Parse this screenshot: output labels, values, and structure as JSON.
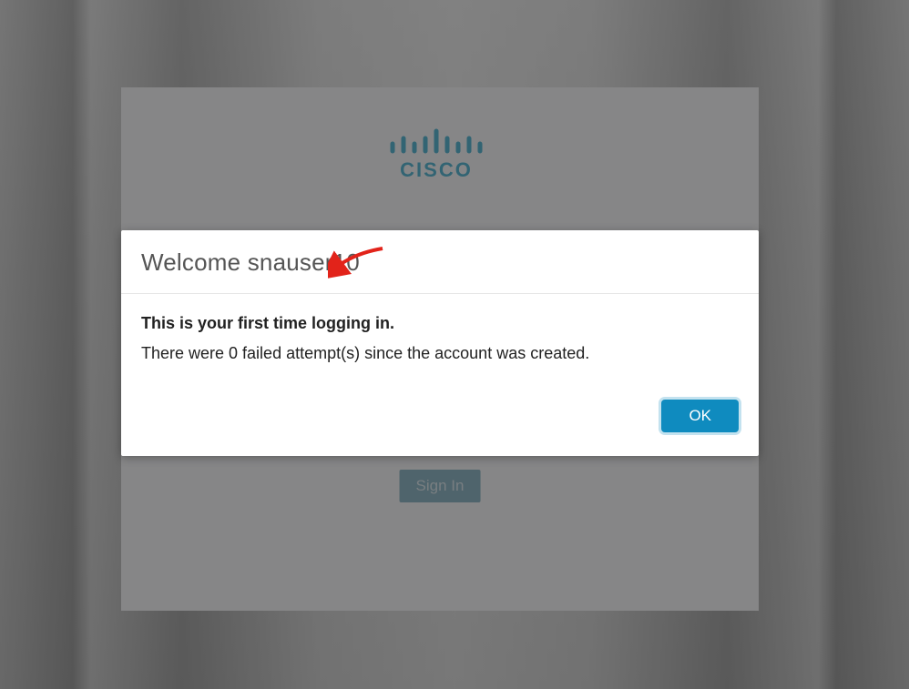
{
  "brand": {
    "name": "cisco",
    "color": "#0f7c9e"
  },
  "login": {
    "sign_in_label": "Sign In"
  },
  "dialog": {
    "title": "Welcome snauser10",
    "first_time_message": "This is your first time logging in.",
    "attempts_message": "There were 0 failed attempt(s) since the account was created.",
    "ok_label": "OK"
  },
  "annotation": {
    "arrow_color": "#d22"
  }
}
